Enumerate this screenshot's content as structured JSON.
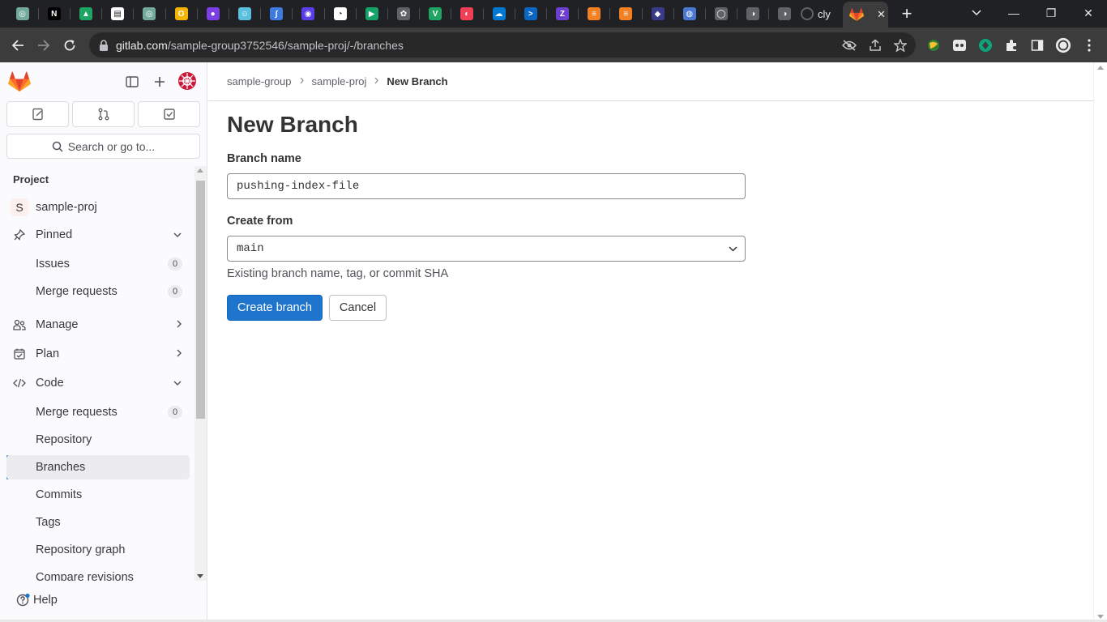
{
  "browser": {
    "tabs": [
      {
        "icon": "chatgpt-icon",
        "color": "#74aa9c",
        "glyph": "◎"
      },
      {
        "icon": "notion-icon",
        "color": "#000000",
        "glyph": "N"
      },
      {
        "icon": "codepen-icon",
        "color": "#1fa463",
        "glyph": "▲"
      },
      {
        "icon": "notion-page-icon",
        "color": "#ffffff",
        "glyph": "▤"
      },
      {
        "icon": "chatgpt-icon",
        "color": "#74aa9c",
        "glyph": "◎"
      },
      {
        "icon": "outlook-icon",
        "color": "#f4b400",
        "glyph": "O"
      },
      {
        "icon": "circle-app-icon",
        "color": "#7b3fe4",
        "glyph": "●"
      },
      {
        "icon": "bot-icon",
        "color": "#5bc0de",
        "glyph": "☺"
      },
      {
        "icon": "feather-icon",
        "color": "#3d7be0",
        "glyph": "∫"
      },
      {
        "icon": "eye-app-icon",
        "color": "#5c3ee8",
        "glyph": "◉"
      },
      {
        "icon": "pie-icon",
        "color": "#ffffff",
        "glyph": "◔"
      },
      {
        "icon": "play-icon",
        "color": "#16a36a",
        "glyph": "▶"
      },
      {
        "icon": "openai-icon",
        "color": "#5f6368",
        "glyph": "✿"
      },
      {
        "icon": "vuetify-icon",
        "color": "#1fa463",
        "glyph": "V"
      },
      {
        "icon": "pocket-icon",
        "color": "#ef4056",
        "glyph": "◐"
      },
      {
        "icon": "onedrive-icon",
        "color": "#0078d4",
        "glyph": "☁"
      },
      {
        "icon": "terminal-icon",
        "color": "#0a66c2",
        "glyph": ">"
      },
      {
        "icon": "zotero-icon",
        "color": "#6c3fd1",
        "glyph": "Z"
      },
      {
        "icon": "stackoverflow-icon",
        "color": "#f48024",
        "glyph": "≡"
      },
      {
        "icon": "stackoverflow-icon",
        "color": "#f48024",
        "glyph": "≡"
      },
      {
        "icon": "avatar-icon",
        "color": "#3a3a8a",
        "glyph": "◆"
      },
      {
        "icon": "globe-app-icon",
        "color": "#4a78d0",
        "glyph": "◍"
      },
      {
        "icon": "github-icon",
        "color": "#5f6368",
        "glyph": "◯"
      },
      {
        "icon": "globe-icon",
        "color": "#5f6368",
        "glyph": "◑"
      },
      {
        "icon": "globe-icon",
        "color": "#5f6368",
        "glyph": "◑"
      }
    ],
    "partial_tab_title": "cly",
    "active_tab_icon": "gitlab-icon",
    "url_host": "gitlab.com",
    "url_path": "/sample-group3752546/sample-proj/-/branches",
    "window": {
      "minimize": "—",
      "restore": "❐",
      "close": "✕"
    }
  },
  "sidebar": {
    "search_placeholder": "Search or go to...",
    "section_title": "Project",
    "project_name": "sample-proj",
    "project_initial": "S",
    "items": {
      "pinned": "Pinned",
      "issues": "Issues",
      "issues_count": "0",
      "merge_requests": "Merge requests",
      "merge_requests_count": "0",
      "manage": "Manage",
      "plan": "Plan",
      "code": "Code",
      "code_merge_requests": "Merge requests",
      "code_merge_requests_count": "0",
      "repository": "Repository",
      "branches": "Branches",
      "commits": "Commits",
      "tags": "Tags",
      "repository_graph": "Repository graph",
      "compare_revisions": "Compare revisions"
    },
    "help": "Help"
  },
  "breadcrumb": {
    "group": "sample-group",
    "project": "sample-proj",
    "current": "New Branch"
  },
  "form": {
    "title": "New Branch",
    "branch_name_label": "Branch name",
    "branch_name_value": "pushing-index-file",
    "create_from_label": "Create from",
    "create_from_value": "main",
    "create_from_help": "Existing branch name, tag, or commit SHA",
    "create_button": "Create branch",
    "cancel_button": "Cancel"
  },
  "colors": {
    "primary": "#1f75cb",
    "sidebar_bg": "#fbfafd",
    "gitlab_orange": "#fc6d26"
  }
}
